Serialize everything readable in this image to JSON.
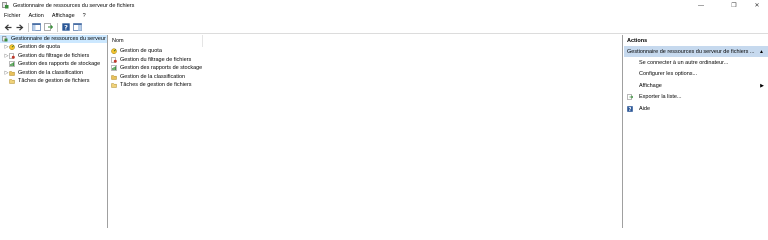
{
  "window": {
    "title": "Gestionnaire de ressources du serveur de fichiers",
    "minimize": "—",
    "restore": "❐",
    "close": "✕"
  },
  "menu": {
    "items": [
      "Fichier",
      "Action",
      "Affichage",
      "?"
    ]
  },
  "tree": {
    "root": "Gestionnaire de ressources du serveur",
    "items": [
      {
        "label": "Gestion de quota",
        "expandable": true,
        "icon": "quota-icon"
      },
      {
        "label": "Gestion du filtrage de fichiers",
        "expandable": true,
        "icon": "file-screen-icon"
      },
      {
        "label": "Gestion des rapports de stockage",
        "expandable": false,
        "icon": "storage-report-icon"
      },
      {
        "label": "Gestion de la classification",
        "expandable": true,
        "icon": "classification-icon"
      },
      {
        "label": "Tâches de gestion de fichiers",
        "expandable": false,
        "icon": "file-task-icon"
      }
    ]
  },
  "list": {
    "column_name": "Nom",
    "rows": [
      "Gestion de quota",
      "Gestion du filtrage de fichiers",
      "Gestion des rapports de stockage",
      "Gestion de la classification",
      "Tâches de gestion de fichiers"
    ]
  },
  "actions": {
    "header": "Actions",
    "section": "Gestionnaire de ressources du serveur de fichiers ...",
    "items": [
      {
        "label": "Se connecter à un autre ordinateur...",
        "icon": null
      },
      {
        "label": "Configurer les options...",
        "icon": null
      },
      {
        "label": "Affichage",
        "icon": null,
        "submenu": true
      },
      {
        "label": "Exporter la liste...",
        "icon": "export-icon"
      },
      {
        "label": "Aide",
        "icon": "help-icon"
      }
    ]
  }
}
